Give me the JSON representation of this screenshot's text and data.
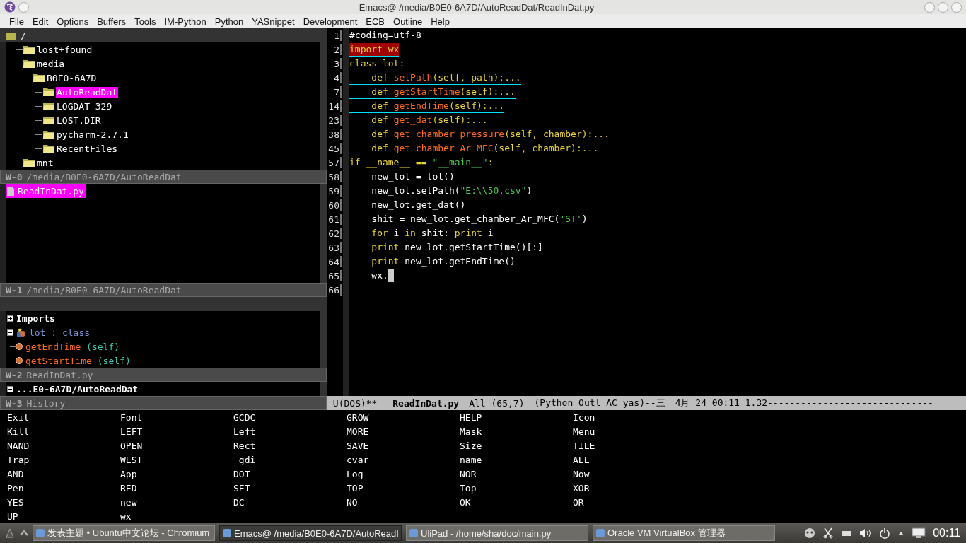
{
  "window": {
    "title": "Emacs@ /media/B0E0-6A7D/AutoReadDat/ReadInDat.py"
  },
  "menu": [
    "File",
    "Edit",
    "Options",
    "Buffers",
    "Tools",
    "IM-Python",
    "Python",
    "YASnippet",
    "Development",
    "ECB",
    "Outline",
    "Help"
  ],
  "directories": {
    "root": "/",
    "tree": [
      {
        "label": "lost+found",
        "selected": false
      },
      {
        "label": "media",
        "selected": false,
        "children": [
          {
            "label": "B0E0-6A7D",
            "selected": false,
            "children": [
              {
                "label": "AutoReadDat",
                "selected": true
              },
              {
                "label": "LOGDAT-329",
                "selected": false
              },
              {
                "label": "LOST.DIR",
                "selected": false
              },
              {
                "label": "pycharm-2.7.1",
                "selected": false
              },
              {
                "label": "RecentFiles",
                "selected": false
              }
            ]
          }
        ]
      },
      {
        "label": "mnt",
        "selected": false
      }
    ],
    "status": {
      "tag": "W-0",
      "text": "/media/B0E0-6A7D/AutoReadDat"
    }
  },
  "sources": {
    "files": [
      {
        "label": "ReadInDat.py",
        "selected": true
      }
    ],
    "status": {
      "tag": "W-1",
      "text": "/media/B0E0-6A7D/AutoReadDat"
    }
  },
  "methods": {
    "items": [
      {
        "kind": "group",
        "label": "Imports",
        "expanded": false
      },
      {
        "kind": "class",
        "label": "lot : class",
        "expanded": true
      },
      {
        "kind": "method",
        "name": "getEndTime",
        "args": "(self)"
      },
      {
        "kind": "method",
        "name": "getStartTime",
        "args": "(self)"
      }
    ],
    "status": {
      "tag": "W-2",
      "text": "ReadInDat.py"
    }
  },
  "history": {
    "items": [
      {
        "label": "...E0-6A7D/AutoReadDat",
        "expanded": true
      }
    ],
    "status": {
      "tag": "W-3",
      "text": "History"
    }
  },
  "editor": {
    "lines": [
      {
        "number": "1",
        "underlined": false,
        "highlighted": false,
        "cursor": false,
        "tokens": [
          {
            "kind": "plain",
            "text": "#coding=utf-8"
          }
        ]
      },
      {
        "number": "2",
        "underlined": true,
        "highlighted": true,
        "cursor": false,
        "tokens": [
          {
            "kind": "kw",
            "text": "import wx"
          }
        ]
      },
      {
        "number": "3",
        "underlined": false,
        "highlighted": false,
        "cursor": false,
        "tokens": [
          {
            "kind": "kw",
            "text": "class lot:"
          }
        ]
      },
      {
        "number": "4",
        "underlined": true,
        "highlighted": false,
        "cursor": false,
        "tokens": [
          {
            "kind": "kw",
            "text": "    def "
          },
          {
            "kind": "fn",
            "text": "setPath"
          },
          {
            "kind": "kw",
            "text": "(self, path):..."
          }
        ]
      },
      {
        "number": "7",
        "underlined": true,
        "highlighted": false,
        "cursor": false,
        "tokens": [
          {
            "kind": "kw",
            "text": "    def "
          },
          {
            "kind": "fn",
            "text": "getStartTime"
          },
          {
            "kind": "kw",
            "text": "(self):..."
          }
        ]
      },
      {
        "number": "14",
        "underlined": true,
        "highlighted": false,
        "cursor": false,
        "tokens": [
          {
            "kind": "kw",
            "text": "    def "
          },
          {
            "kind": "fn",
            "text": "getEndTime"
          },
          {
            "kind": "kw",
            "text": "(self):..."
          }
        ]
      },
      {
        "number": "23",
        "underlined": true,
        "highlighted": false,
        "cursor": false,
        "tokens": [
          {
            "kind": "kw",
            "text": "    def "
          },
          {
            "kind": "fn",
            "text": "get_dat"
          },
          {
            "kind": "kw",
            "text": "(self):..."
          }
        ]
      },
      {
        "number": "38",
        "underlined": true,
        "highlighted": false,
        "cursor": false,
        "tokens": [
          {
            "kind": "kw",
            "text": "    def "
          },
          {
            "kind": "fn",
            "text": "get_chamber_pressure"
          },
          {
            "kind": "kw",
            "text": "(self, chamber):..."
          }
        ]
      },
      {
        "number": "45",
        "underlined": false,
        "highlighted": false,
        "cursor": false,
        "tokens": [
          {
            "kind": "kw",
            "text": "    def "
          },
          {
            "kind": "fn",
            "text": "get_chamber_Ar_MFC"
          },
          {
            "kind": "kw",
            "text": "(self, chamber):..."
          }
        ]
      },
      {
        "number": "57",
        "underlined": false,
        "highlighted": false,
        "cursor": false,
        "tokens": [
          {
            "kind": "kw",
            "text": "if __name__ == "
          },
          {
            "kind": "str",
            "text": "\"__main__\""
          },
          {
            "kind": "kw",
            "text": ":"
          }
        ]
      },
      {
        "number": "58",
        "underlined": false,
        "highlighted": false,
        "cursor": false,
        "tokens": [
          {
            "kind": "plain",
            "text": "    new_lot = lot()"
          }
        ]
      },
      {
        "number": "59",
        "underlined": false,
        "highlighted": false,
        "cursor": false,
        "tokens": [
          {
            "kind": "plain",
            "text": "    new_lot.setPath("
          },
          {
            "kind": "str",
            "text": "\"E:\\\\50.csv\""
          },
          {
            "kind": "plain",
            "text": ")"
          }
        ]
      },
      {
        "number": "60",
        "underlined": false,
        "highlighted": false,
        "cursor": false,
        "tokens": [
          {
            "kind": "plain",
            "text": "    new_lot.get_dat()"
          }
        ]
      },
      {
        "number": "61",
        "underlined": false,
        "highlighted": false,
        "cursor": false,
        "tokens": [
          {
            "kind": "plain",
            "text": "    shit = new_lot.get_chamber_Ar_MFC("
          },
          {
            "kind": "str",
            "text": "'ST'"
          },
          {
            "kind": "plain",
            "text": ")"
          }
        ]
      },
      {
        "number": "62",
        "underlined": false,
        "highlighted": false,
        "cursor": false,
        "tokens": [
          {
            "kind": "kw",
            "text": "    for"
          },
          {
            "kind": "plain",
            "text": " i "
          },
          {
            "kind": "kw",
            "text": "in"
          },
          {
            "kind": "plain",
            "text": " shit: "
          },
          {
            "kind": "kw",
            "text": "print"
          },
          {
            "kind": "plain",
            "text": " i"
          }
        ]
      },
      {
        "number": "63",
        "underlined": false,
        "highlighted": false,
        "cursor": false,
        "tokens": [
          {
            "kind": "kw",
            "text": "    print"
          },
          {
            "kind": "plain",
            "text": " new_lot.getStartTime()[:]"
          }
        ]
      },
      {
        "number": "64",
        "underlined": false,
        "highlighted": false,
        "cursor": false,
        "tokens": [
          {
            "kind": "kw",
            "text": "    print"
          },
          {
            "kind": "plain",
            "text": " new_lot.getEndTime()"
          }
        ]
      },
      {
        "number": "65",
        "underlined": false,
        "highlighted": false,
        "cursor": true,
        "tokens": [
          {
            "kind": "plain",
            "text": "    wx."
          }
        ]
      },
      {
        "number": "66",
        "cursor": false
      }
    ],
    "mode_line": {
      "flags": "-U(DOS)**-",
      "buffer": "ReadInDat.py",
      "position": "All (65,7)",
      "modes": "(Python Outl AC yas)--三",
      "time": "4月 24 00:11 1.32------------------------------"
    }
  },
  "completions": [
    [
      "Exit",
      "Font",
      "GCDC",
      "GROW",
      "HELP",
      "Icon"
    ],
    [
      "Kill",
      "LEFT",
      "Left",
      "MORE",
      "Mask",
      "Menu"
    ],
    [
      "NAND",
      "OPEN",
      "Rect",
      "SAVE",
      "Size",
      "TILE"
    ],
    [
      "Trap",
      "WEST",
      "_gdi",
      "cvar",
      "name",
      "ALL"
    ],
    [
      "AND",
      "App",
      "DOT",
      "Log",
      "NOR",
      "Now"
    ],
    [
      "Pen",
      "RED",
      "SET",
      "TOP",
      "Top",
      "XOR"
    ],
    [
      "YES",
      "new",
      "DC",
      "NO",
      "OK",
      "OR"
    ],
    [
      "UP",
      "wx"
    ]
  ],
  "taskbar": {
    "windows": [
      {
        "label": "发表主题 • Ubuntu中文论坛 - Chromium",
        "selected": false
      },
      {
        "label": "Emacs@ /media/B0E0-6A7D/AutoReadI",
        "selected": true
      },
      {
        "label": "UliPad - /home/sha/doc/main.py",
        "selected": false
      },
      {
        "label": "Oracle VM VirtualBox 管理器",
        "selected": false
      }
    ],
    "clock": "00:11"
  }
}
